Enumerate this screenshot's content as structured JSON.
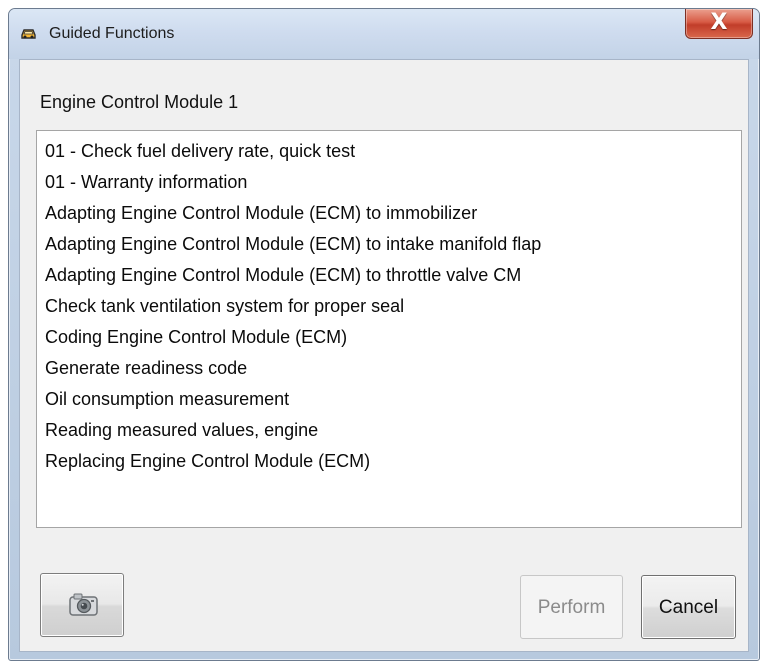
{
  "window": {
    "title": "Guided Functions",
    "close_label": "X"
  },
  "module": {
    "label": "Engine Control Module 1"
  },
  "functions": [
    "01 - Check fuel delivery rate, quick test",
    "01 - Warranty information",
    "Adapting Engine Control Module (ECM) to immobilizer",
    "Adapting Engine Control Module (ECM) to intake manifold flap",
    "Adapting Engine Control Module (ECM) to throttle valve CM",
    "Check tank ventilation system for proper seal",
    "Coding Engine Control Module (ECM)",
    "Generate readiness code",
    "Oil consumption measurement",
    "Reading measured values, engine",
    "Replacing Engine Control Module (ECM)"
  ],
  "buttons": {
    "perform_label": "Perform",
    "cancel_label": "Cancel",
    "perform_enabled": false
  },
  "icons": {
    "app": "car-icon",
    "camera": "camera-icon",
    "close": "close-icon"
  },
  "colors": {
    "title_bar": "#cfdcef",
    "close_button": "#d75b45",
    "disabled_text": "#8b8b8b",
    "list_background": "#ffffff"
  }
}
